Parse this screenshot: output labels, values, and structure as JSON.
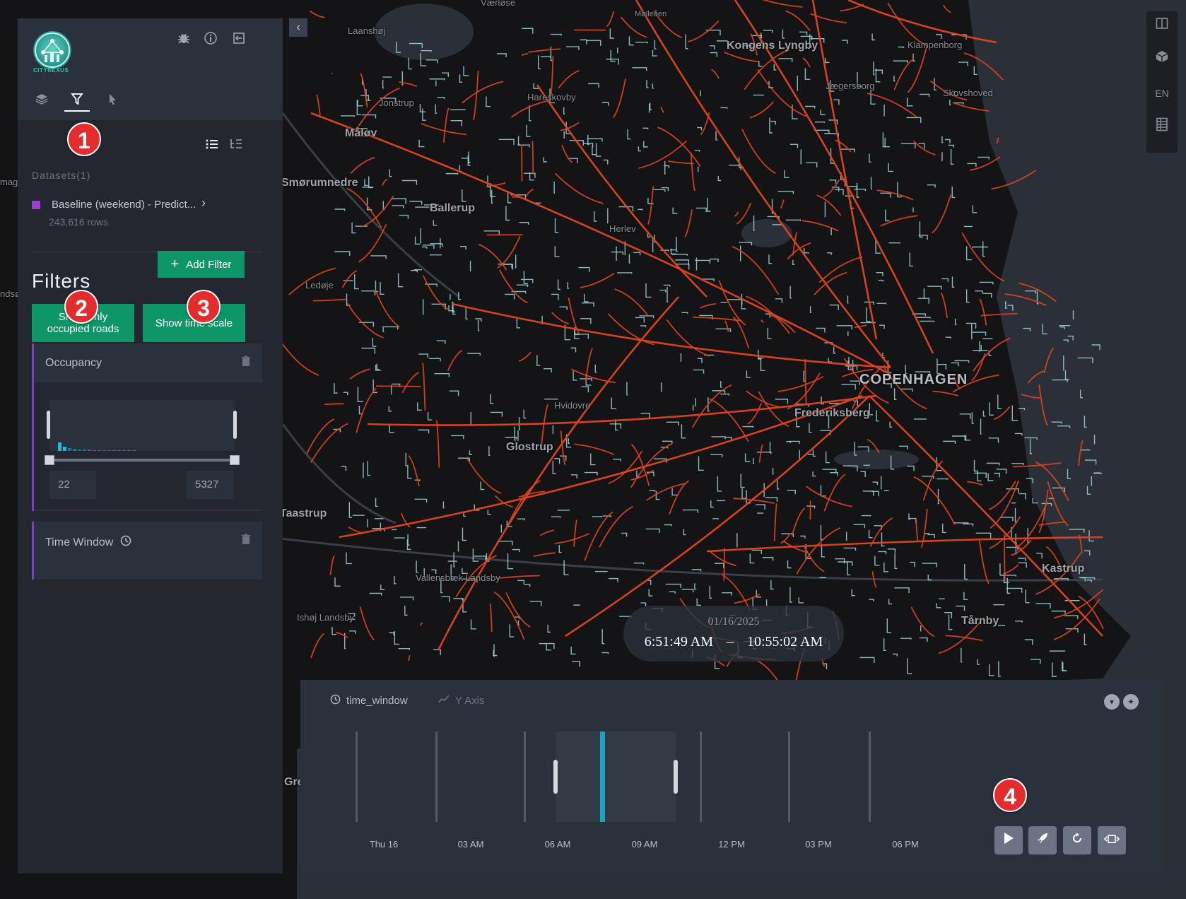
{
  "app": {
    "logo_text": "CITYNEXUS"
  },
  "header_icons": [
    "bug-icon",
    "info-icon",
    "export-icon"
  ],
  "tabs": [
    {
      "name": "layers",
      "icon": "layers-icon",
      "active": false
    },
    {
      "name": "filters",
      "icon": "filter-icon",
      "active": true
    },
    {
      "name": "interactions",
      "icon": "cursor-icon",
      "active": false
    }
  ],
  "datasets": {
    "title": "Datasets(1)",
    "items": [
      {
        "name": "Baseline (weekend) - Predict...",
        "rows": "243,616 rows",
        "color": "#9b3fd1"
      }
    ]
  },
  "filters": {
    "title": "Filters",
    "add_filter_label": "Add Filter",
    "add_filter_icon": "+",
    "show_occupied_label": "Show only occupied roads",
    "show_time_scale_label": "Show time scale",
    "occupancy": {
      "title": "Occupancy",
      "min": "22",
      "max": "5327"
    },
    "time_window": {
      "title": "Time Window"
    }
  },
  "badges": [
    "1",
    "2",
    "3",
    "4"
  ],
  "map": {
    "labels": {
      "vaerlose": "Værløse",
      "laanshoj": "Laanshøj",
      "mollesen": "Mølleåen",
      "kongens_lyngby": "Kongens Lyngby",
      "klampenborg": "Klampenborg",
      "jonstrup": "Jonstrup",
      "hareskovby": "Hareskovby",
      "jaegersborg": "Jægersborg",
      "skovshoved": "Skovshoved",
      "maloev": "Måløv",
      "smorumnedre": "Smørumnedre",
      "ballerup": "Ballerup",
      "herlev": "Herlev",
      "ledoje": "Ledøje",
      "copenhagen": "COPENHAGEN",
      "frederiksberg": "Frederiksberg",
      "hvidovre": "Hvidovre",
      "glostrup": "Glostrup",
      "taastrup": "Taastrup",
      "vallensbaek": "Vallensbæk Landsby",
      "ishoj": "Ishøj Landsby",
      "kastrup": "Kastrup",
      "tarnby": "Tårnby",
      "gre": "Gre",
      "magl": "magl",
      "ndsø": "ndsø"
    },
    "colors": {
      "road_primary": "#e0441f",
      "road_secondary": "#9ed6dc",
      "background": "#141416"
    }
  },
  "right_toolbar": {
    "split_icon": "split-map-icon",
    "cube_icon": "3d-cube-icon",
    "language": "EN",
    "legend_icon": "legend-icon"
  },
  "time_overlay": {
    "date": "01/16/2025",
    "start": "6:51:49 AM",
    "separator": "–",
    "end": "10:55:02 AM"
  },
  "timeline": {
    "field_label": "time_window",
    "y_axis_label": "Y Axis",
    "axis_labels": [
      "Thu 16",
      "03 AM",
      "06 AM",
      "09 AM",
      "12 PM",
      "03 PM",
      "06 PM"
    ],
    "selection_start_fraction": 0.354,
    "selection_end_fraction": 0.566,
    "cursor_fraction": 0.433,
    "buttons": [
      "play-icon",
      "speed-icon",
      "reset-icon",
      "window-icon"
    ]
  }
}
